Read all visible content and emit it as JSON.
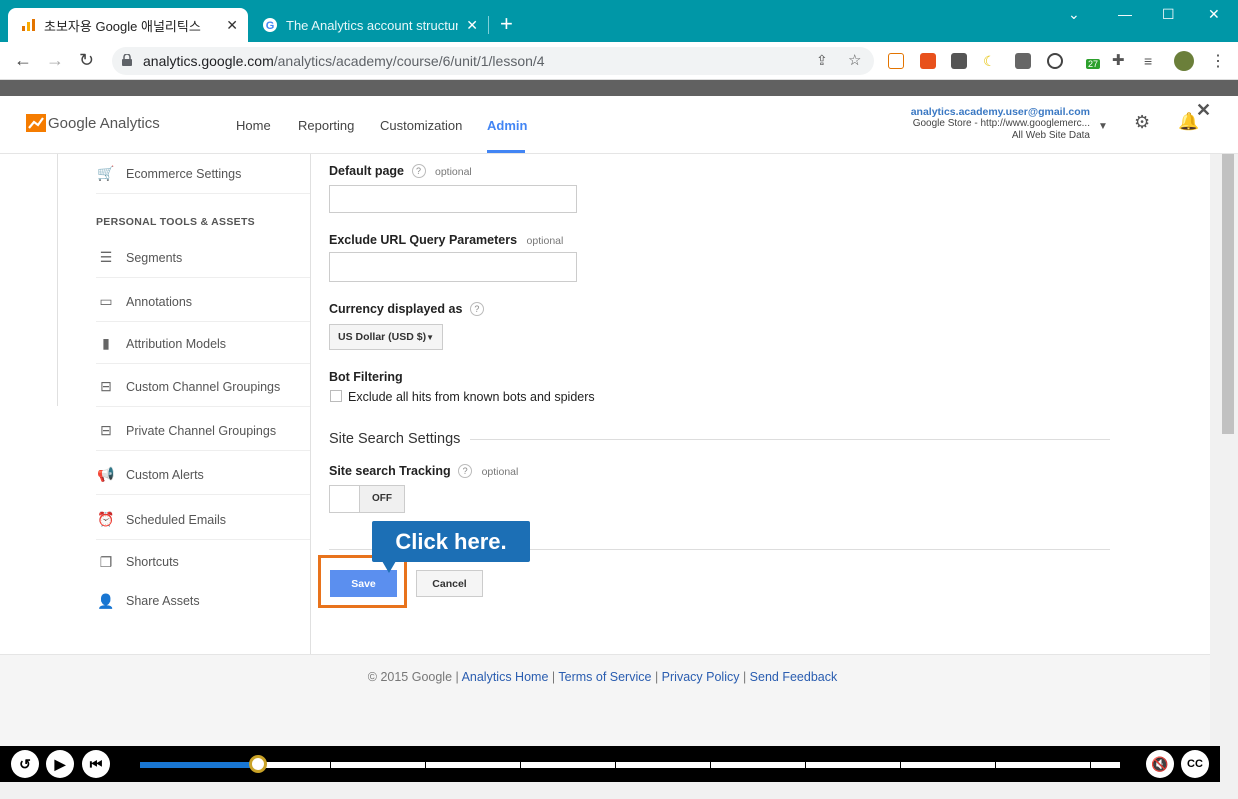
{
  "browser": {
    "tabs": [
      {
        "title": "초보자용 Google 애널리틱스",
        "active": true
      },
      {
        "title": "The Analytics account structure",
        "active": false
      }
    ],
    "url_host": "analytics.google.com",
    "url_path": "/analytics/academy/course/6/unit/1/lesson/4",
    "extension_badge": "27",
    "extension_icons": [
      "calendar-icon",
      "ex-icon",
      "i-icon",
      "moon-icon",
      "c-icon",
      "wordpress-icon",
      "flag-icon",
      "puzzle-icon",
      "playlist-icon",
      "profile-avatar"
    ]
  },
  "ga": {
    "brand": "Google Analytics",
    "nav": [
      "Home",
      "Reporting",
      "Customization",
      "Admin"
    ],
    "active_nav": "Admin",
    "account_email": "analytics.academy.user@gmail.com",
    "account_property": "Google Store - http://www.googlemerc...",
    "account_view": "All Web Site Data"
  },
  "sidebar": {
    "items_top": [
      {
        "label": "Ecommerce Settings",
        "icon": "cart-icon"
      }
    ],
    "section_title": "PERSONAL TOOLS & ASSETS",
    "items": [
      {
        "label": "Segments",
        "icon": "segments-icon"
      },
      {
        "label": "Annotations",
        "icon": "comment-icon"
      },
      {
        "label": "Attribution Models",
        "icon": "bar-chart-icon"
      },
      {
        "label": "Custom Channel Groupings",
        "icon": "channel-icon"
      },
      {
        "label": "Private Channel Groupings",
        "icon": "channel-icon"
      },
      {
        "label": "Custom Alerts",
        "icon": "megaphone-icon"
      },
      {
        "label": "Scheduled Emails",
        "icon": "alarm-clock-icon"
      },
      {
        "label": "Shortcuts",
        "icon": "copy-icon"
      },
      {
        "label": "Share Assets",
        "icon": "add-person-icon"
      }
    ]
  },
  "form": {
    "default_page_label": "Default page",
    "default_page_optional": "optional",
    "default_page_value": "",
    "exclude_label": "Exclude URL Query Parameters",
    "exclude_optional": "optional",
    "exclude_value": "",
    "currency_label": "Currency displayed as",
    "currency_value": "US Dollar (USD $)",
    "bot_label": "Bot Filtering",
    "bot_checkbox_label": "Exclude all hits from known bots and spiders",
    "bot_checked": false,
    "site_search_heading": "Site Search Settings",
    "site_search_tracking_label": "Site search Tracking",
    "site_search_optional": "optional",
    "toggle_state": "OFF",
    "save_label": "Save",
    "cancel_label": "Cancel",
    "help_glyph": "?"
  },
  "callout": "Click here.",
  "footer": {
    "copyright": "© 2015 Google",
    "links": [
      "Analytics Home",
      "Terms of Service",
      "Privacy Policy",
      "Send Feedback"
    ]
  },
  "player": {
    "progress_fraction": 0.12
  },
  "colors": {
    "browser_frame": "#0097a7",
    "ga_accent": "#4285f4",
    "save_button": "#5b8fef",
    "highlight_border": "#e8731c",
    "callout": "#1c6fb5",
    "progress": "#1976d2"
  }
}
